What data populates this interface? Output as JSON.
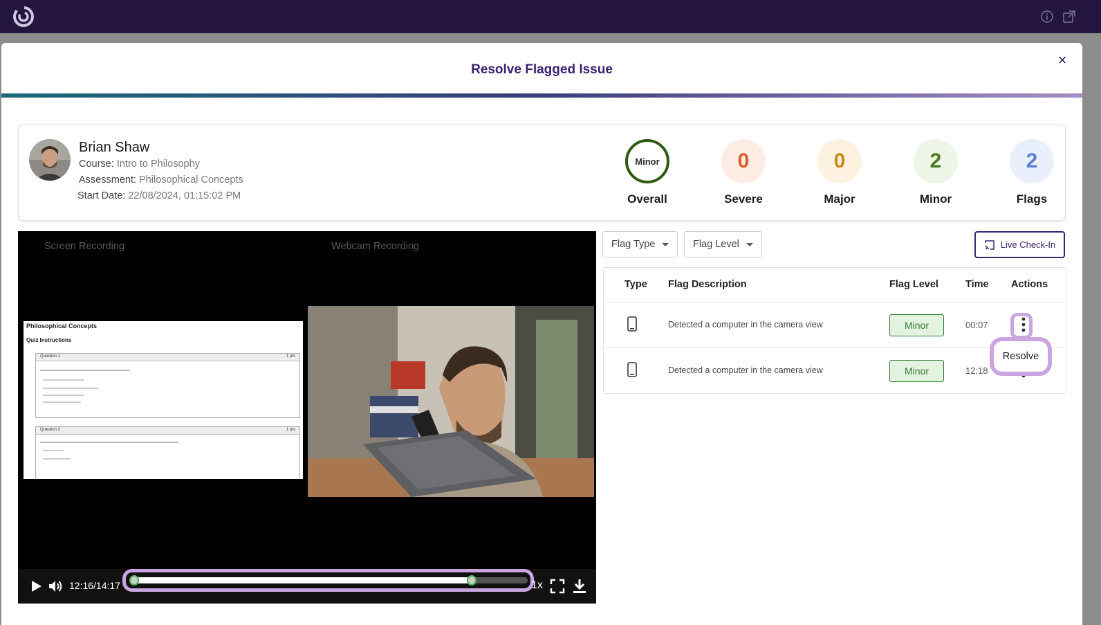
{
  "modal": {
    "title": "Resolve Flagged Issue",
    "close_symbol": "×"
  },
  "student": {
    "name": "Brian Shaw",
    "course_label": "Course:",
    "course": "Intro to Philosophy",
    "assessment_label": "Assessment:",
    "assessment": "Philosophical Concepts",
    "start_label": "Start Date:",
    "start_date": "22/08/2024, 01:15:02 PM"
  },
  "stats": [
    {
      "label": "Overall",
      "value": "Minor",
      "color": "#2f5a12"
    },
    {
      "label": "Severe",
      "value": "0",
      "color": "#e05a2b"
    },
    {
      "label": "Major",
      "value": "0",
      "color": "#c98a1a"
    },
    {
      "label": "Minor",
      "value": "2",
      "color": "#4a7a1e"
    },
    {
      "label": "Flags",
      "value": "2",
      "color": "#5a7fd6"
    }
  ],
  "video": {
    "screen_label": "Screen Recording",
    "webcam_label": "Webcam Recording",
    "time": "12:16/14:17",
    "progress": 0.86,
    "speed": "1x",
    "quiz": {
      "title": "Philosophical Concepts",
      "subtitle": "Quiz Instructions",
      "q1": "Question 1",
      "q2": "Question 2",
      "pts": "1 pts"
    }
  },
  "filters": {
    "flag_type": "Flag Type",
    "flag_level": "Flag Level",
    "live_checkin": "Live Check-In"
  },
  "table": {
    "headers": {
      "type": "Type",
      "description": "Flag Description",
      "level": "Flag Level",
      "time": "Time",
      "actions": "Actions"
    },
    "rows": [
      {
        "description": "Detected a computer in the camera view",
        "level": "Minor",
        "time": "00:07"
      },
      {
        "description": "Detected a computer in the camera view",
        "level": "Minor",
        "time": "12:18"
      }
    ]
  },
  "popover": {
    "resolve": "Resolve"
  },
  "icons": {
    "logo": "swirl-logo-icon",
    "info": "info-icon",
    "external": "external-link-icon",
    "play": "play-icon",
    "volume": "volume-icon",
    "fullscreen": "fullscreen-icon",
    "download": "download-icon",
    "device": "mobile-device-icon",
    "kebab": "kebab-menu-icon",
    "cast": "cast-icon"
  }
}
